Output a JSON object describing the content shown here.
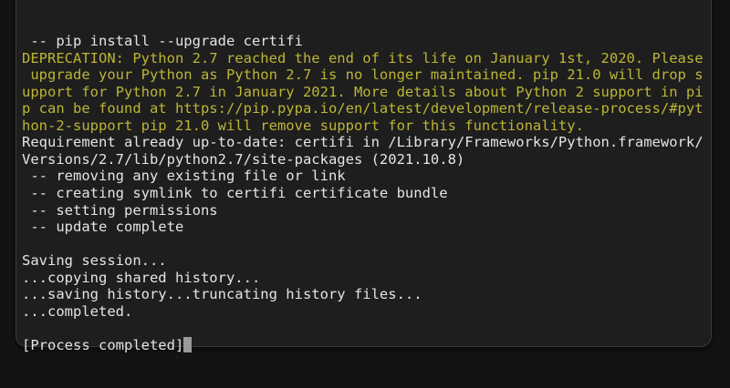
{
  "terminal": {
    "lines": [
      {
        "text": " -- pip install --upgrade certifi",
        "kind": "normal"
      },
      {
        "text": "DEPRECATION: Python 2.7 reached the end of its life on January 1st, 2020. Please",
        "kind": "warn"
      },
      {
        "text": " upgrade your Python as Python 2.7 is no longer maintained. pip 21.0 will drop s",
        "kind": "warn"
      },
      {
        "text": "upport for Python 2.7 in January 2021. More details about Python 2 support in pi",
        "kind": "warn"
      },
      {
        "text": "p can be found at https://pip.pypa.io/en/latest/development/release-process/#pyt",
        "kind": "warn"
      },
      {
        "text": "hon-2-support pip 21.0 will remove support for this functionality.",
        "kind": "warn"
      },
      {
        "text": "Requirement already up-to-date: certifi in /Library/Frameworks/Python.framework/",
        "kind": "normal"
      },
      {
        "text": "Versions/2.7/lib/python2.7/site-packages (2021.10.8)",
        "kind": "normal"
      },
      {
        "text": " -- removing any existing file or link",
        "kind": "normal"
      },
      {
        "text": " -- creating symlink to certifi certificate bundle",
        "kind": "normal"
      },
      {
        "text": " -- setting permissions",
        "kind": "normal"
      },
      {
        "text": " -- update complete",
        "kind": "normal"
      },
      {
        "text": "",
        "kind": "normal"
      },
      {
        "text": "Saving session...",
        "kind": "normal"
      },
      {
        "text": "...copying shared history...",
        "kind": "normal"
      },
      {
        "text": "...saving history...truncating history files...",
        "kind": "normal"
      },
      {
        "text": "...completed.",
        "kind": "normal"
      },
      {
        "text": "",
        "kind": "normal"
      }
    ],
    "final_line": "[Process completed]",
    "colors": {
      "background": "#1e1e1e",
      "text": "#e4e4e4",
      "warning": "#bdb535",
      "cursor": "#9a9a9a"
    }
  }
}
